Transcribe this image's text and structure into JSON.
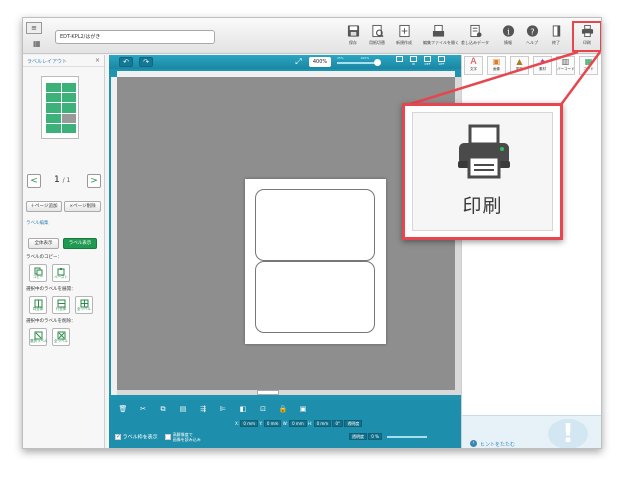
{
  "titlebar": {
    "document_name": "EDT-KPL2/はがき"
  },
  "toolbar": {
    "items": [
      {
        "id": "save",
        "label": "保存",
        "icon": "save-icon"
      },
      {
        "id": "preview",
        "label": "用紙切替",
        "icon": "preview-icon"
      },
      {
        "id": "new",
        "label": "新規作成",
        "icon": "new-doc-icon"
      },
      {
        "id": "open",
        "label": "編集ファイルを開く",
        "icon": "open-file-icon"
      },
      {
        "id": "data",
        "label": "差し込みデータ",
        "icon": "data-icon"
      },
      {
        "id": "info",
        "label": "情報",
        "icon": "info-icon"
      },
      {
        "id": "help",
        "label": "ヘルプ",
        "icon": "help-icon"
      },
      {
        "id": "exit",
        "label": "終了",
        "icon": "exit-icon"
      },
      {
        "id": "print",
        "label": "印刷",
        "icon": "printer-icon"
      }
    ]
  },
  "left_panel": {
    "title": "ラベルレイアウト",
    "close": "×",
    "page_current": "1",
    "page_total": "/ 1",
    "page_prev": "<",
    "page_next": ">",
    "add_page": "＋ページ追加",
    "delete_page": "×ページ削除",
    "label_edit": "ラベル編集",
    "show_all": "全体表示",
    "show_label": "ラベル表示",
    "copy_section": "ラベルのコピー：",
    "copy_btn": "コピー",
    "paste_btn": "ペースト",
    "expand_section": "選択中のラベルを展開：",
    "expand_items": [
      "同全体",
      "行全体",
      "全ラベル"
    ],
    "delete_section": "選択中のラベルを削除：",
    "delete_items": [
      "選択ラベル",
      "全ラベル"
    ]
  },
  "canvas": {
    "zoom": "400%",
    "zoom_min": "25%",
    "zoom_max": "400%",
    "view_modes": [
      "",
      "W",
      "DEF",
      "OFF"
    ],
    "coord_labels": {
      "x": "X:",
      "y": "Y:",
      "w": "W:",
      "h": "H:"
    },
    "coord_values": {
      "x": "0 mm",
      "y": "0 mm",
      "w": "0 mm",
      "h": "0 mm"
    },
    "angle": "0°",
    "transparency_label": "透明度",
    "opacity_label": "透明度",
    "opacity_value": "0 %",
    "show_frame": "ラベル枠を表示",
    "high_res": "高解像度で",
    "high_res_sub": "画像を読み込み"
  },
  "right_panel": {
    "tabs": [
      {
        "label": "文字",
        "color": "#d64545",
        "glyph": "A"
      },
      {
        "label": "画像",
        "color": "#e07b22",
        "glyph": "▣"
      },
      {
        "label": "図形",
        "color": "#b07a1e",
        "glyph": "▲"
      },
      {
        "label": "素材",
        "color": "#a040a0",
        "glyph": "✦"
      },
      {
        "label": "バーコード",
        "color": "#555555",
        "glyph": "▥"
      },
      {
        "label": "コード",
        "color": "#1f9a51",
        "glyph": "▦"
      }
    ],
    "hint": "ヒントをたたむ"
  },
  "callout": {
    "label": "印刷",
    "icon": "printer-icon"
  },
  "colors": {
    "accent": "#1f93b0",
    "highlight": "#e8464f",
    "green": "#1f9a51"
  }
}
